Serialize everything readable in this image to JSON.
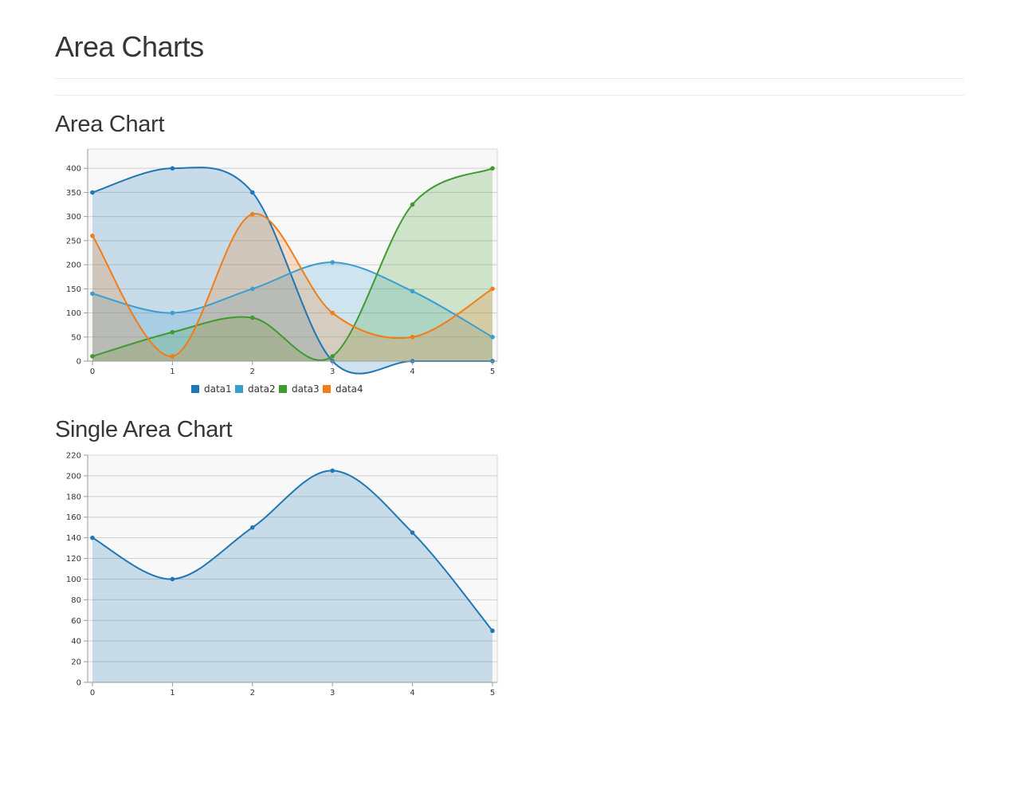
{
  "page": {
    "title": "Area Charts"
  },
  "sections": [
    {
      "title": "Area Chart"
    },
    {
      "title": "Single Area Chart"
    }
  ],
  "chart_data": [
    {
      "type": "area",
      "title": "Area Chart",
      "x": [
        0,
        1,
        2,
        3,
        4,
        5
      ],
      "xlim": [
        0,
        5
      ],
      "ylim": [
        0,
        440
      ],
      "yticks": [
        0,
        50,
        100,
        150,
        200,
        250,
        300,
        350,
        400
      ],
      "grid": true,
      "legend": "bottom",
      "series": [
        {
          "name": "data1",
          "values": [
            350,
            400,
            350,
            0,
            0,
            0
          ],
          "color": "#1f77b4"
        },
        {
          "name": "data2",
          "values": [
            140,
            100,
            150,
            205,
            145,
            50
          ],
          "color": "#3a9fd0"
        },
        {
          "name": "data3",
          "values": [
            10,
            60,
            90,
            10,
            325,
            400
          ],
          "color": "#3f9a2f"
        },
        {
          "name": "data4",
          "values": [
            260,
            10,
            305,
            100,
            50,
            150
          ],
          "color": "#f07d16"
        }
      ]
    },
    {
      "type": "area",
      "title": "Single Area Chart",
      "x": [
        0,
        1,
        2,
        3,
        4,
        5
      ],
      "xlim": [
        0,
        5
      ],
      "ylim": [
        0,
        220
      ],
      "yticks": [
        0,
        20,
        40,
        60,
        80,
        100,
        120,
        140,
        160,
        180,
        200,
        220
      ],
      "grid": true,
      "legend": "none",
      "series": [
        {
          "values": [
            140,
            100,
            150,
            205,
            145,
            50
          ],
          "color": "#1f77b4"
        }
      ]
    }
  ]
}
